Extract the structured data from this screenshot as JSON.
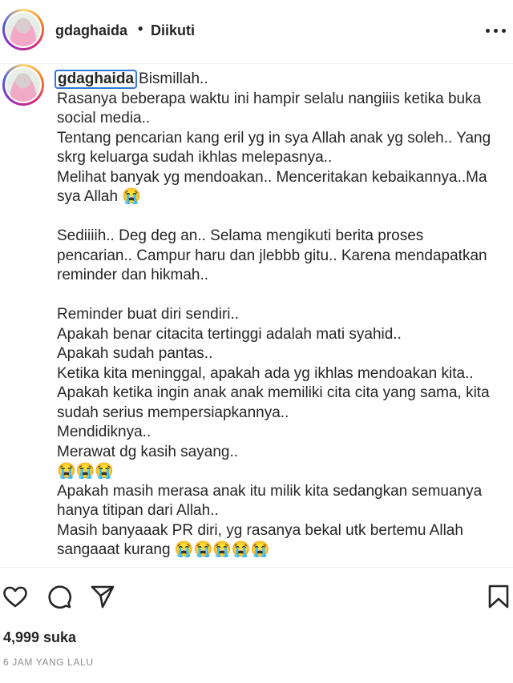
{
  "header": {
    "username": "gdaghaida",
    "separator": "•",
    "follow_status": "Diikuti",
    "more_icon": "more-horizontal-icon"
  },
  "caption": {
    "username": "gdaghaida",
    "first_line": "Bismillah..",
    "lines": [
      "Rasanya beberapa waktu ini hampir selalu nangiiis ketika buka",
      "social media..",
      "Tentang pencarian kang eril yg in sya Allah anak yg soleh.. Yang",
      "skrg keluarga sudah ikhlas melepasnya..",
      "Melihat banyak yg mendoakan.. Menceritakan kebaikannya..Ma",
      "sya Allah 😭",
      "",
      "Sediiiih.. Deg deg an.. Selama mengikuti berita proses",
      "pencarian.. Campur haru dan jlebbb gitu.. Karena mendapatkan",
      "reminder dan hikmah..",
      "",
      "Reminder buat diri sendiri..",
      "Apakah benar citacita tertinggi adalah mati syahid..",
      "Apakah sudah pantas..",
      "Ketika kita meninggal, apakah ada yg ikhlas mendoakan kita..",
      "Apakah ketika ingin anak anak memiliki cita cita yang sama, kita",
      "sudah serius mempersiapkannya..",
      "Mendidiknya..",
      "Merawat dg kasih sayang..",
      "😭😭😭",
      "Apakah masih merasa anak itu milik kita sedangkan semuanya",
      "hanya titipan dari Allah..",
      "Masih banyaaak PR diri, yg rasanya bekal utk bertemu Allah",
      "sangaaat kurang 😭😭😭😭😭"
    ]
  },
  "actions": {
    "like_icon": "heart-icon",
    "comment_icon": "comment-icon",
    "share_icon": "send-icon",
    "save_icon": "bookmark-icon"
  },
  "likes": "4,999 suka",
  "timestamp": "6 JAM YANG LALU"
}
